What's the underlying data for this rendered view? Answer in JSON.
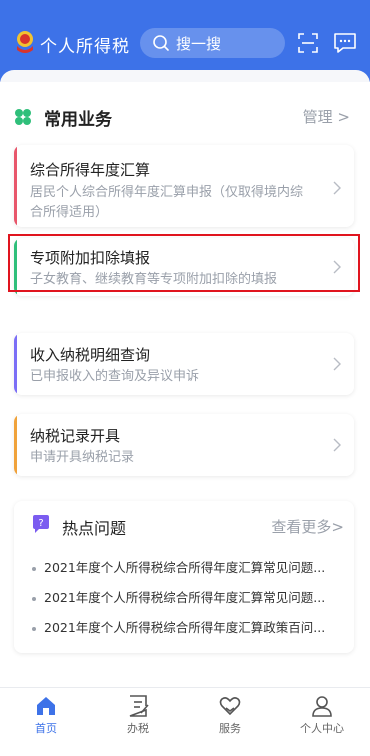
{
  "header": {
    "app_title": "个人所得税",
    "search_placeholder": "搜一搜"
  },
  "section": {
    "title": "常用业务",
    "manage_label": "管理 >"
  },
  "cards": [
    {
      "title": "综合所得年度汇算",
      "subtitle": "居民个人综合所得年度汇算申报（仅取得境内综合所得适用）",
      "accent": "#e8566b"
    },
    {
      "title": "专项附加扣除填报",
      "subtitle": "子女教育、继续教育等专项附加扣除的填报",
      "accent": "#2fbf7a"
    },
    {
      "title": "收入纳税明细查询",
      "subtitle": "已申报收入的查询及异议申诉",
      "accent": "#7b6ef6"
    },
    {
      "title": "纳税记录开具",
      "subtitle": "申请开具纳税记录",
      "accent": "#f0a23a"
    }
  ],
  "hot": {
    "title": "热点问题",
    "more_label": "查看更多>",
    "items": [
      "2021年度个人所得税综合所得年度汇算常见问题...",
      "2021年度个人所得税综合所得年度汇算常见问题...",
      "2021年度个人所得税综合所得年度汇算政策百问..."
    ]
  },
  "nav": {
    "home": "首页",
    "tax": "办税",
    "service": "服务",
    "personal": "个人中心"
  },
  "colors": {
    "brand_blue": "#3d72e8",
    "highlight_red": "#e0141e"
  }
}
